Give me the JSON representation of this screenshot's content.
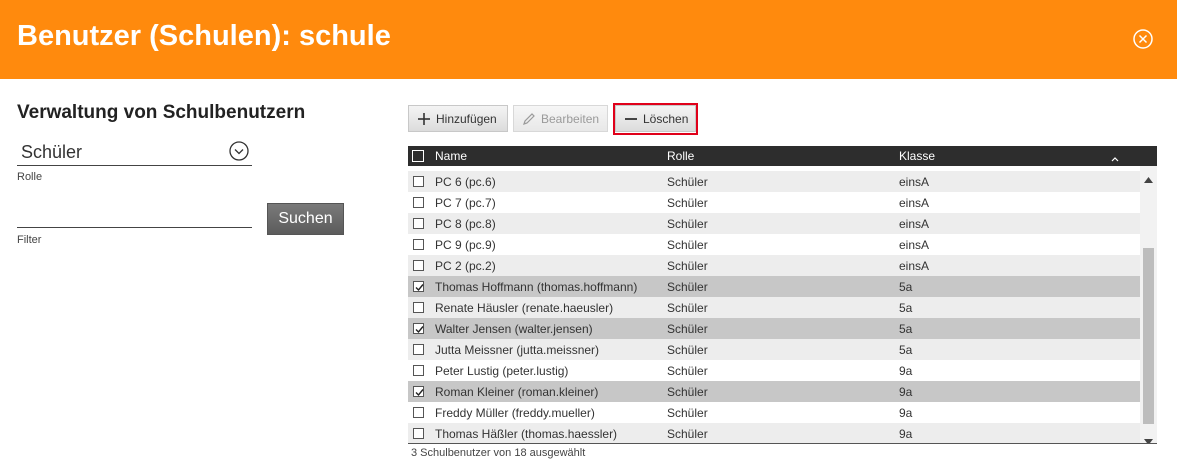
{
  "header": {
    "title": "Benutzer (Schulen): schule",
    "close_icon": "close-circle-icon",
    "bg_color": "#ff8a0d"
  },
  "sidebar": {
    "title": "Verwaltung von Schulbenutzern",
    "role": {
      "value": "Schüler",
      "caption": "Rolle"
    },
    "filter": {
      "value": "",
      "caption": "Filter"
    },
    "search_label": "Suchen"
  },
  "toolbar": {
    "add_label": "Hinzufügen",
    "edit_label": "Bearbeiten",
    "delete_label": "Löschen",
    "highlight_color": "#e0001a"
  },
  "grid": {
    "columns": {
      "name": "Name",
      "role": "Rolle",
      "class": "Klasse"
    },
    "rows": [
      {
        "name": "PC 6 (pc.6)",
        "role": "Schüler",
        "class": "einsA",
        "checked": false
      },
      {
        "name": "PC 7 (pc.7)",
        "role": "Schüler",
        "class": "einsA",
        "checked": false
      },
      {
        "name": "PC 8 (pc.8)",
        "role": "Schüler",
        "class": "einsA",
        "checked": false
      },
      {
        "name": "PC 9 (pc.9)",
        "role": "Schüler",
        "class": "einsA",
        "checked": false
      },
      {
        "name": "PC 2 (pc.2)",
        "role": "Schüler",
        "class": "einsA",
        "checked": false
      },
      {
        "name": "Thomas Hoffmann (thomas.hoffmann)",
        "role": "Schüler",
        "class": "5a",
        "checked": true
      },
      {
        "name": "Renate Häusler (renate.haeusler)",
        "role": "Schüler",
        "class": "5a",
        "checked": false
      },
      {
        "name": "Walter Jensen (walter.jensen)",
        "role": "Schüler",
        "class": "5a",
        "checked": true
      },
      {
        "name": "Jutta Meissner (jutta.meissner)",
        "role": "Schüler",
        "class": "5a",
        "checked": false
      },
      {
        "name": "Peter Lustig (peter.lustig)",
        "role": "Schüler",
        "class": "9a",
        "checked": false
      },
      {
        "name": "Roman Kleiner (roman.kleiner)",
        "role": "Schüler",
        "class": "9a",
        "checked": true
      },
      {
        "name": "Freddy Müller (freddy.mueller)",
        "role": "Schüler",
        "class": "9a",
        "checked": false
      },
      {
        "name": "Thomas Häßler (thomas.haessler)",
        "role": "Schüler",
        "class": "9a",
        "checked": false
      }
    ],
    "status": "3 Schulbenutzer von 18 ausgewählt"
  }
}
